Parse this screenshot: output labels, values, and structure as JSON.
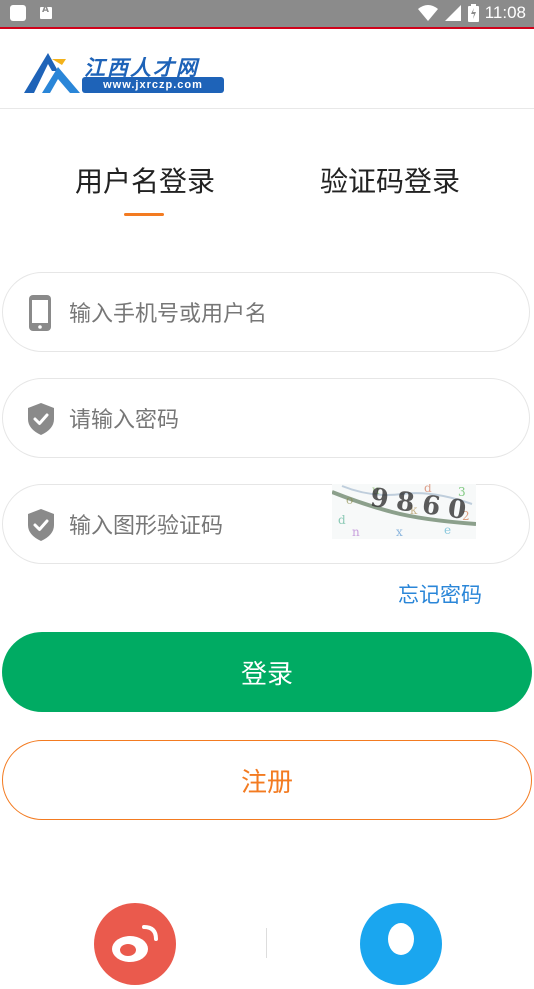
{
  "status_bar": {
    "time": "11:08"
  },
  "header": {
    "logo_name": "江西人才网",
    "logo_url": "www.jxrczp.com"
  },
  "tabs": [
    {
      "label": "用户名登录",
      "active": true
    },
    {
      "label": "验证码登录",
      "active": false
    }
  ],
  "form": {
    "username_placeholder": "输入手机号或用户名",
    "password_placeholder": "请输入密码",
    "captcha_placeholder": "输入图形验证码",
    "captcha_text": "9860",
    "forgot_label": "忘记密码"
  },
  "buttons": {
    "login_label": "登录",
    "register_label": "注册"
  },
  "social": [
    {
      "name": "weibo-icon",
      "color": "#ea5a4d"
    },
    {
      "name": "qq-icon",
      "color": "#1aa6ef"
    }
  ],
  "colors": {
    "accent_orange": "#f37b21",
    "primary_green": "#00ab63",
    "link_blue": "#2a86d8"
  }
}
